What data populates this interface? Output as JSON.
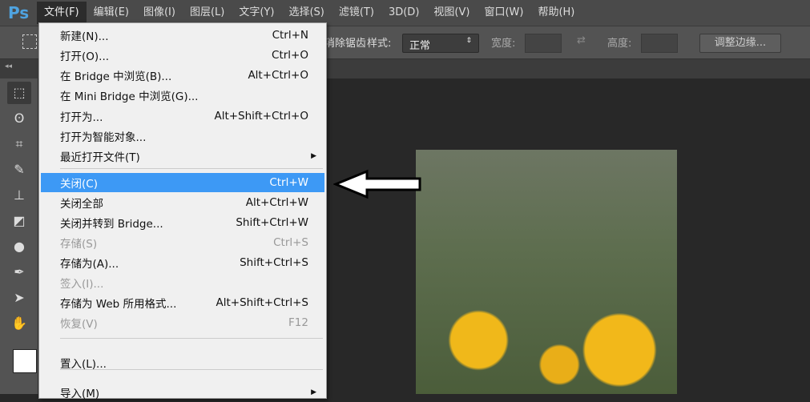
{
  "app": {
    "logo": "Ps"
  },
  "menubar": [
    "文件(F)",
    "编辑(E)",
    "图像(I)",
    "图层(L)",
    "文字(Y)",
    "选择(S)",
    "滤镜(T)",
    "3D(D)",
    "视图(V)",
    "窗口(W)",
    "帮助(H)"
  ],
  "options": {
    "antialias": "消除锯齿",
    "style_label": "样式:",
    "style_value": "正常",
    "width_label": "宽度:",
    "height_label": "高度:",
    "refine_edge": "调整边缘..."
  },
  "file_menu": [
    {
      "label": "新建(N)...",
      "shortcut": "Ctrl+N"
    },
    {
      "label": "打开(O)...",
      "shortcut": "Ctrl+O"
    },
    {
      "label": "在 Bridge 中浏览(B)...",
      "shortcut": "Alt+Ctrl+O"
    },
    {
      "label": "在 Mini Bridge 中浏览(G)...",
      "shortcut": ""
    },
    {
      "label": "打开为...",
      "shortcut": "Alt+Shift+Ctrl+O"
    },
    {
      "label": "打开为智能对象...",
      "shortcut": ""
    },
    {
      "label": "最近打开文件(T)",
      "shortcut": ""
    },
    {
      "label": "关闭(C)",
      "shortcut": "Ctrl+W"
    },
    {
      "label": "关闭全部",
      "shortcut": "Alt+Ctrl+W"
    },
    {
      "label": "关闭并转到 Bridge...",
      "shortcut": "Shift+Ctrl+W"
    },
    {
      "label": "存储(S)",
      "shortcut": "Ctrl+S"
    },
    {
      "label": "存储为(A)...",
      "shortcut": "Shift+Ctrl+S"
    },
    {
      "label": "签入(I)...",
      "shortcut": ""
    },
    {
      "label": "存储为 Web 所用格式...",
      "shortcut": "Alt+Shift+Ctrl+S"
    },
    {
      "label": "恢复(V)",
      "shortcut": "F12"
    },
    {
      "label": "置入(L)...",
      "shortcut": ""
    },
    {
      "label": "导入(M)",
      "shortcut": ""
    }
  ]
}
